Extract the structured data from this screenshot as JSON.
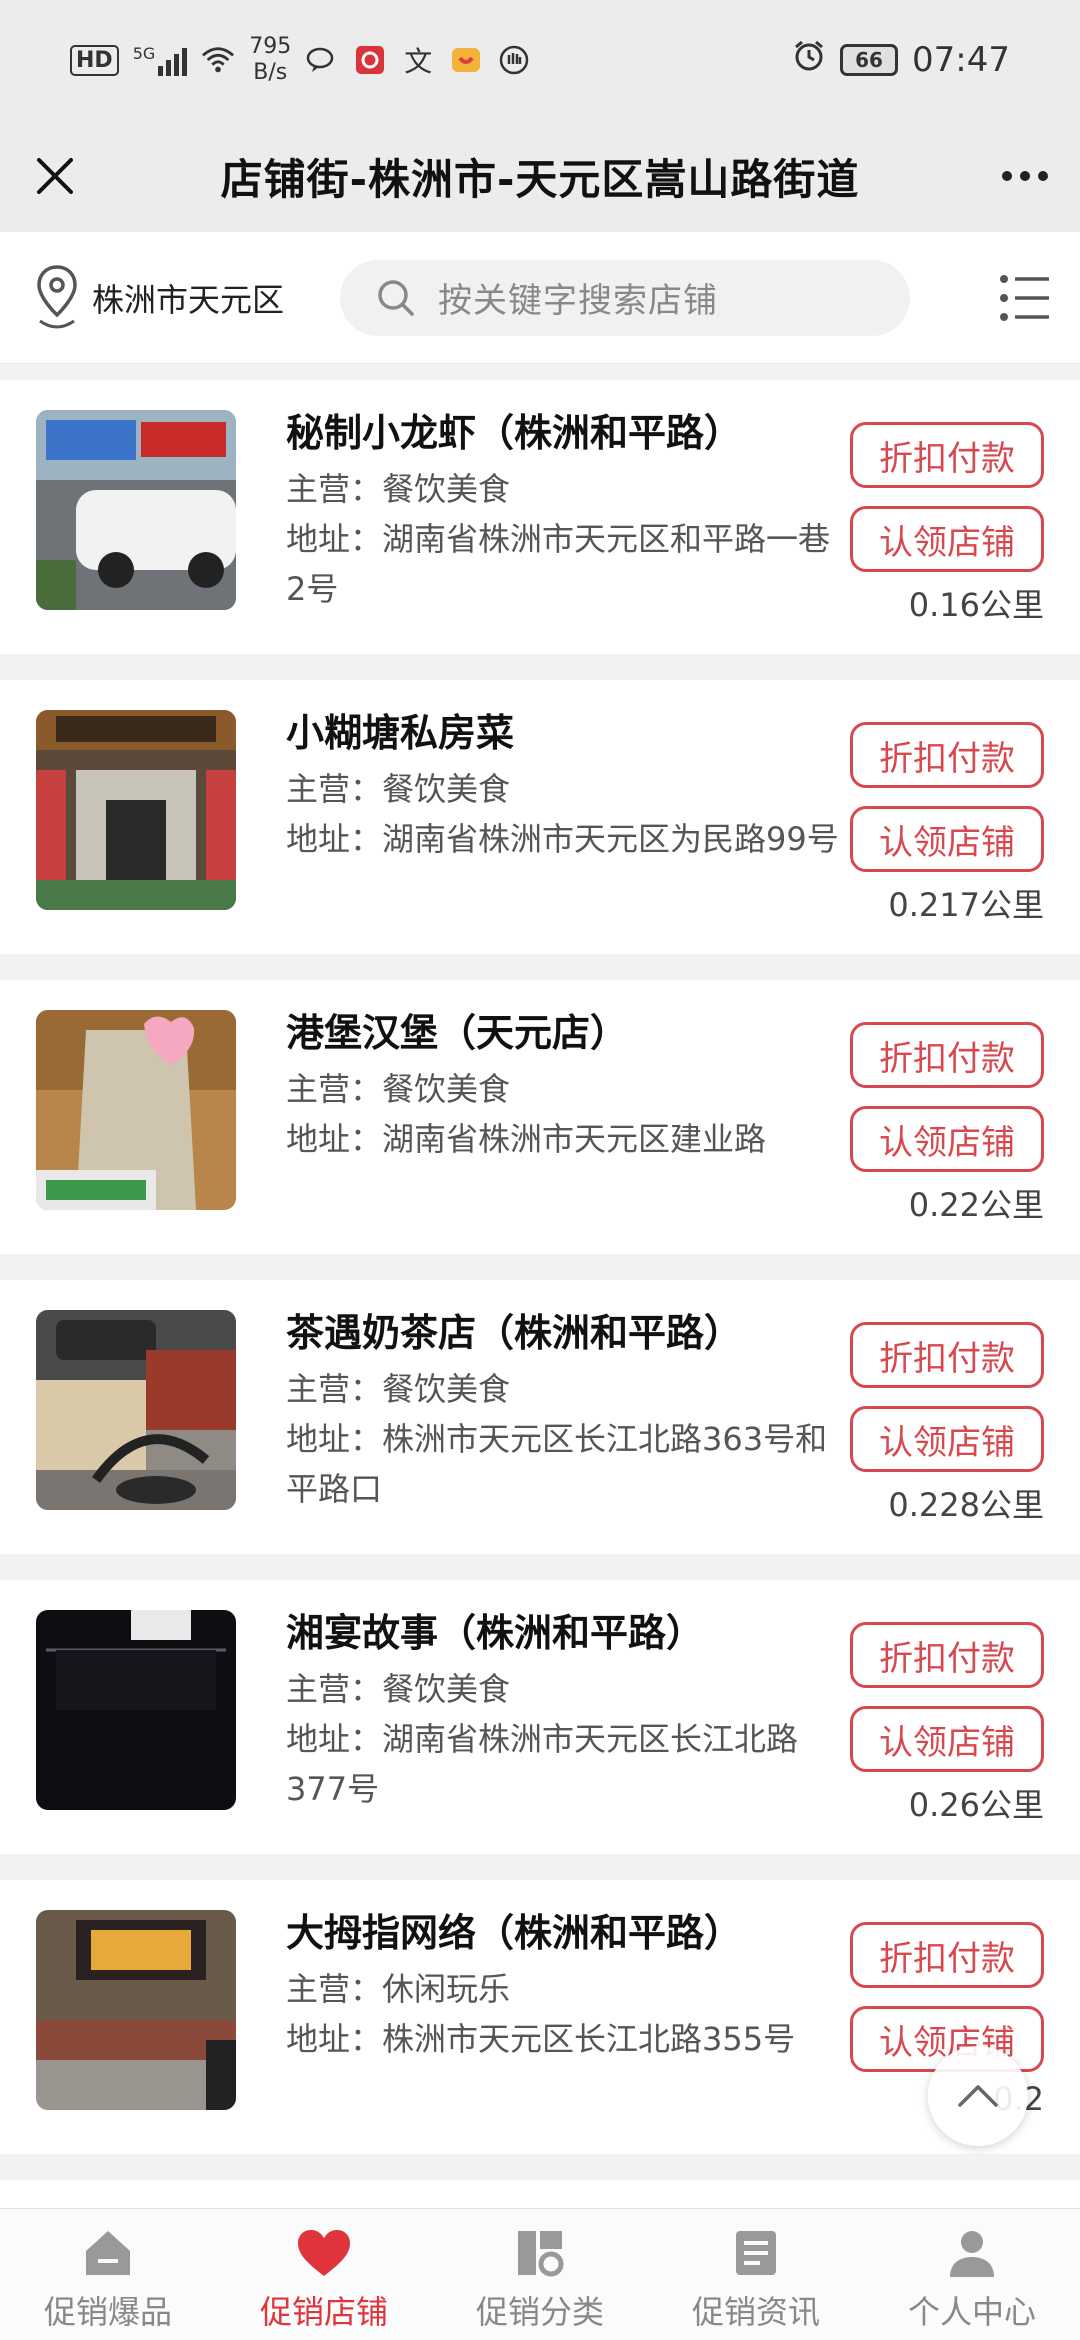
{
  "status_bar": {
    "hd": "HD",
    "signal": "5G",
    "speed_value": "795",
    "speed_unit": "B/s",
    "battery": "66",
    "time": "07:47"
  },
  "title_bar": {
    "title": "店铺街-株洲市-天元区嵩山路街道"
  },
  "search_row": {
    "location": "株洲市天元区",
    "placeholder": "按关键字搜索店铺"
  },
  "stores": [
    {
      "name": "秘制小龙虾（株洲和平路）",
      "category": "主营：餐饮美食",
      "address": "地址：湖南省株洲市天元区和平路一巷2号",
      "distance": "0.16公里",
      "btn_pay": "折扣付款",
      "btn_claim": "认领店铺"
    },
    {
      "name": "小糊塘私房菜",
      "category": "主营：餐饮美食",
      "address": "地址：湖南省株洲市天元区为民路99号",
      "distance": "0.217公里",
      "btn_pay": "折扣付款",
      "btn_claim": "认领店铺"
    },
    {
      "name": "港堡汉堡（天元店）",
      "category": "主营：餐饮美食",
      "address": "地址：湖南省株洲市天元区建业路",
      "distance": "0.22公里",
      "btn_pay": "折扣付款",
      "btn_claim": "认领店铺"
    },
    {
      "name": "茶遇奶茶店（株洲和平路）",
      "category": "主营：餐饮美食",
      "address": "地址：株洲市天元区长江北路363号和平路口",
      "distance": "0.228公里",
      "btn_pay": "折扣付款",
      "btn_claim": "认领店铺"
    },
    {
      "name": "湘宴故事（株洲和平路）",
      "category": "主营：餐饮美食",
      "address": "地址：湖南省株洲市天元区长江北路377号",
      "distance": "0.26公里",
      "btn_pay": "折扣付款",
      "btn_claim": "认领店铺"
    },
    {
      "name": "大拇指网络（株洲和平路）",
      "category": "主营：休闲玩乐",
      "address": "地址：株洲市天元区长江北路355号",
      "distance": "0.2",
      "btn_pay": "折扣付款",
      "btn_claim": "认领店铺"
    }
  ],
  "bottom_nav": [
    {
      "label": "促销爆品",
      "icon": "home-icon",
      "active": false
    },
    {
      "label": "促销店铺",
      "icon": "heart-icon",
      "active": true
    },
    {
      "label": "促销分类",
      "icon": "category-icon",
      "active": false
    },
    {
      "label": "促销资讯",
      "icon": "news-icon",
      "active": false
    },
    {
      "label": "个人中心",
      "icon": "user-icon",
      "active": false
    }
  ],
  "colors": {
    "accent": "#d8484f",
    "active_nav": "#e0343d",
    "background": "#f2f2f2"
  }
}
